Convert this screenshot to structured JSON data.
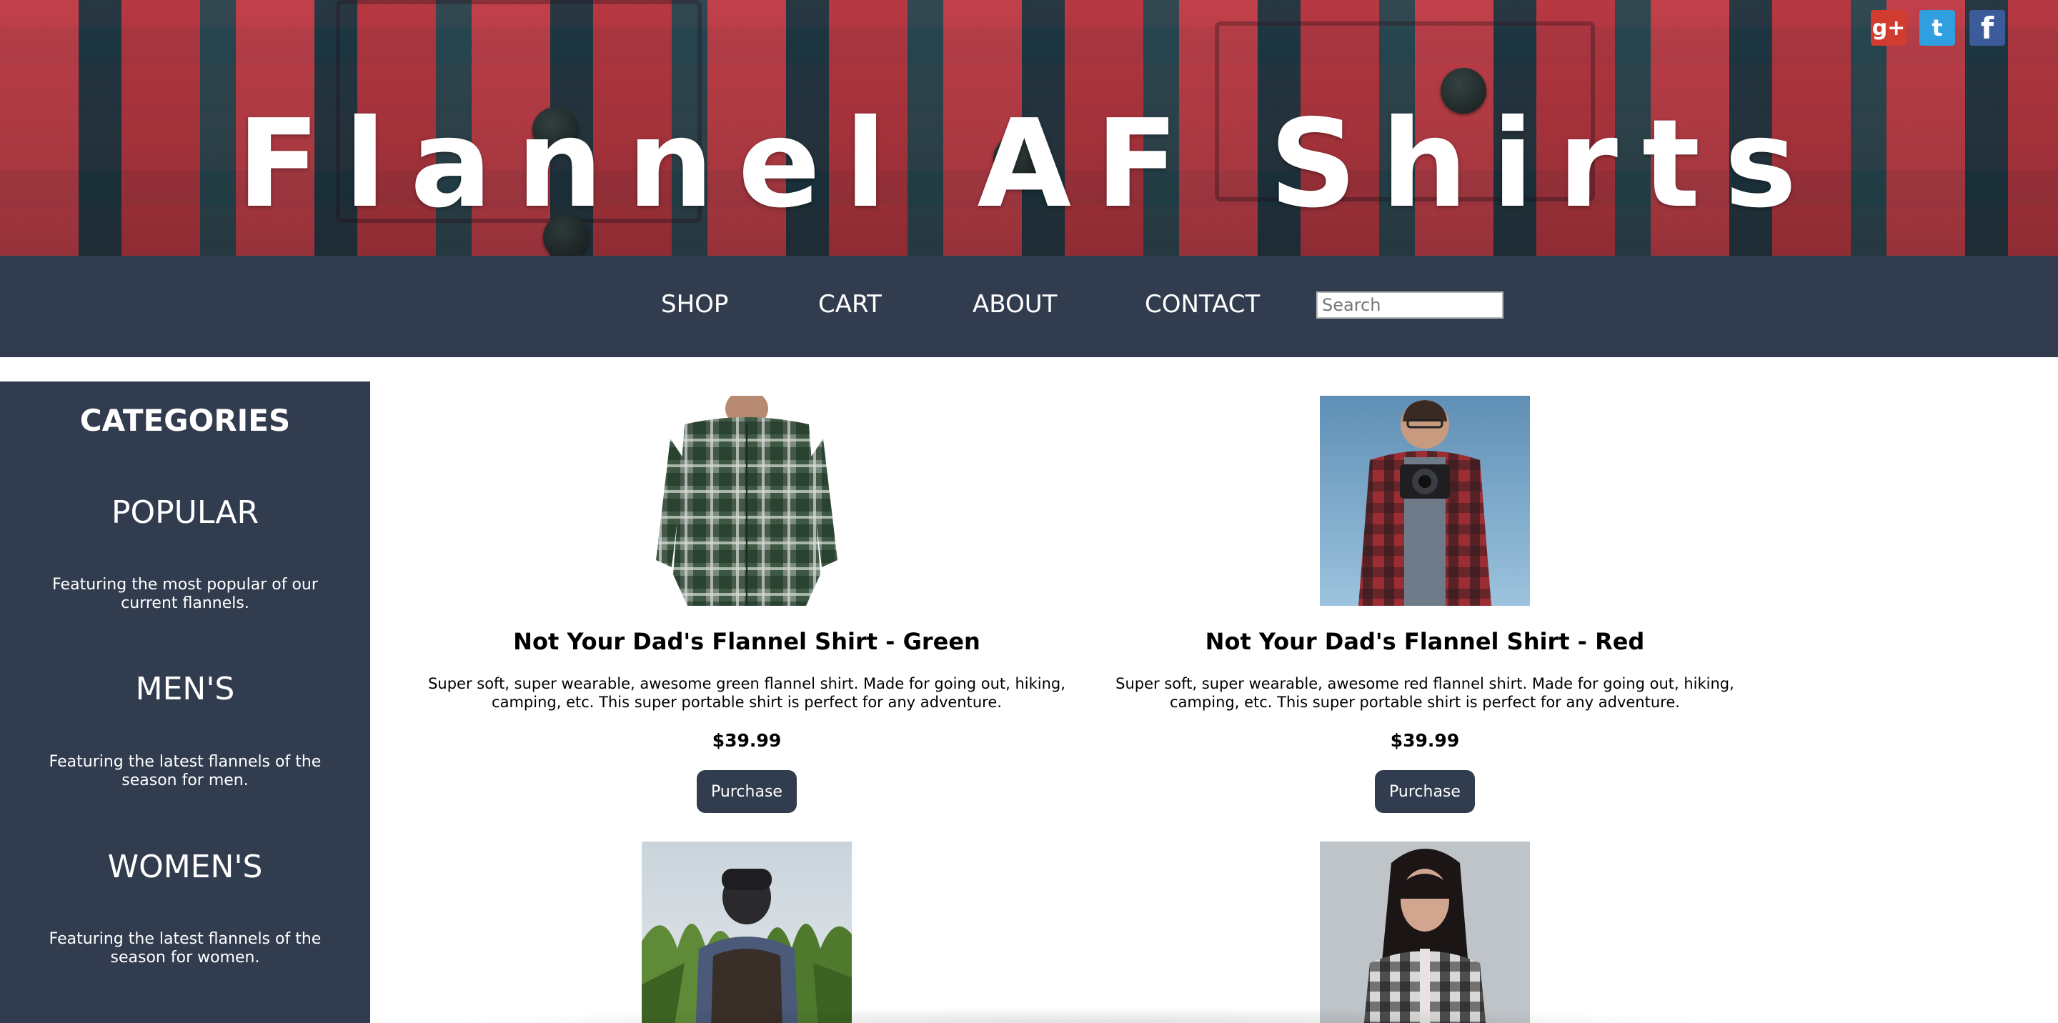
{
  "hero": {
    "title": "Flannel AF Shirts"
  },
  "social": {
    "gplus_glyph": "g+",
    "twitter_glyph": "t",
    "facebook_glyph": "f"
  },
  "nav": {
    "items": [
      {
        "label": "SHOP"
      },
      {
        "label": "CART"
      },
      {
        "label": "ABOUT"
      },
      {
        "label": "CONTACT"
      }
    ],
    "search_placeholder": "Search"
  },
  "sidebar": {
    "heading": "CATEGORIES",
    "categories": [
      {
        "label": "POPULAR",
        "description": "Featuring the most popular of our current flannels."
      },
      {
        "label": "MEN'S",
        "description": "Featuring the latest flannels of the season for men."
      },
      {
        "label": "WOMEN'S",
        "description": "Featuring the latest flannels of the season for women."
      }
    ]
  },
  "products": [
    {
      "title": "Not Your Dad's Flannel Shirt - Green",
      "description": "Super soft, super wearable, awesome green flannel shirt. Made for going out, hiking, camping, etc. This super portable shirt is perfect for any adventure.",
      "price": "$39.99",
      "button": "Purchase",
      "image": "green-flannel-shirt-photo"
    },
    {
      "title": "Not Your Dad's Flannel Shirt - Red",
      "description": "Super soft, super wearable, awesome red flannel shirt. Made for going out, hiking, camping, etc. This super portable shirt is perfect for any adventure.",
      "price": "$39.99",
      "button": "Purchase",
      "image": "red-flannel-camera-photo"
    },
    {
      "image": "cornfield-backpack-photo"
    },
    {
      "image": "woman-plaid-shirt-photo"
    }
  ],
  "colors": {
    "navy": "#323c4f",
    "gplus": "#d23b30",
    "twitter": "#2f9fe0",
    "facebook": "#3b5b9a"
  }
}
